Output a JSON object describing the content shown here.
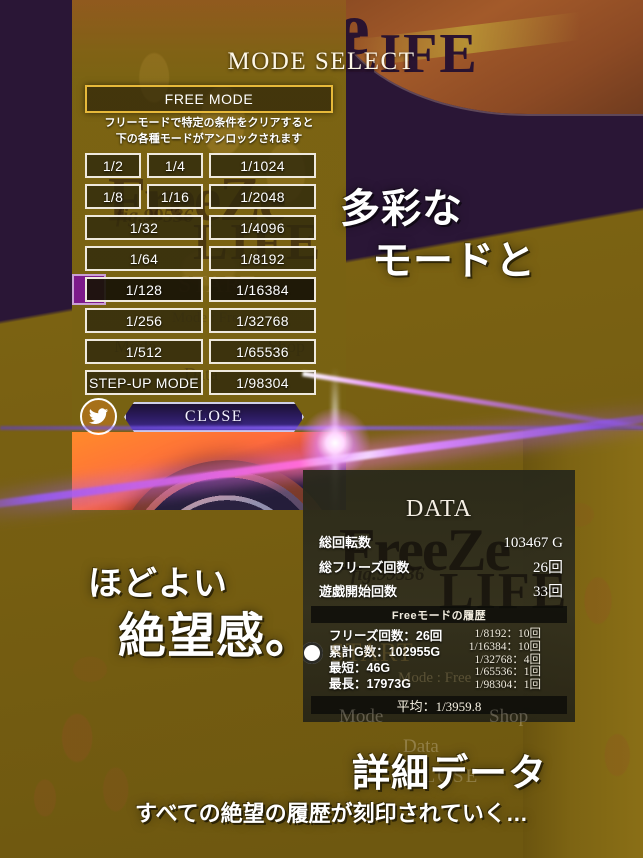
{
  "mode_panel": {
    "title": "MODE SELECT",
    "current_mode_label": "FREE MODE",
    "description_line1": "フリーモードで特定の条件をクリアすると",
    "description_line2": "下の各種モードがアンロックされます",
    "grid_rows": [
      {
        "left": "1/2",
        "mid": "1/4",
        "right": "1/1024",
        "selected": false
      },
      {
        "left": "1/8",
        "mid": "1/16",
        "right": "1/2048",
        "selected": false
      },
      {
        "left": "1/32",
        "mid": null,
        "right": "1/4096",
        "selected": false
      },
      {
        "left": "1/64",
        "mid": null,
        "right": "1/8192",
        "selected": false
      },
      {
        "left": "1/128",
        "mid": null,
        "right": "1/16384",
        "selected": true
      },
      {
        "left": "1/256",
        "mid": null,
        "right": "1/32768",
        "selected": false
      },
      {
        "left": "1/512",
        "mid": null,
        "right": "1/65536",
        "selected": false
      },
      {
        "left": "STEP-UP MODE",
        "mid": null,
        "right": "1/98304",
        "selected": false
      }
    ],
    "close_label": "CLOSE",
    "twitter_icon": "twitter-bird-icon"
  },
  "data_panel": {
    "title": "DATA",
    "stats": [
      {
        "label": "総回転数",
        "value": "103467 G"
      },
      {
        "label": "総フリーズ回数",
        "value": "26回"
      },
      {
        "label": "遊戯開始回数",
        "value": "33回"
      }
    ],
    "history_header": "Freeモードの履歴",
    "history_left": [
      "フリーズ回数：26回",
      "累計G数：102955G",
      "最短：46G",
      "最長：17973G"
    ],
    "history_right": [
      "1/8192：10回",
      "1/16384：10回",
      "1/32768：4回",
      "1/65536：1回",
      "1/98304：1回"
    ],
    "average": "平均：1/3959.8"
  },
  "ghost_ui": {
    "start": "START",
    "mode_free": "Mode : Free",
    "nav_mode": "Mode",
    "nav_shop": "Shop",
    "nav_data": "Data",
    "nav_close": "CLOSE"
  },
  "brand": {
    "logo_line1": "FreeZe",
    "logo_line2": "LIFE",
    "logo_small": "fig.99536",
    "frag_e": "e",
    "frag_life": "LIFE"
  },
  "captions": {
    "modes_line1": "多彩な",
    "modes_line2": "モードと",
    "despair_line1": "ほどよい",
    "despair_line2": "絶望感。",
    "detail_data": "詳細データ",
    "bottom": "すべての絶望の履歴が刻印されていく…"
  },
  "colors": {
    "gold_border": "#e7b93a",
    "panel_olive": "#7a6312",
    "selection_purple": "#7d1a8a",
    "laser_magenta": "#ff6bd6",
    "data_panel_bg": "#2e2c1e"
  }
}
